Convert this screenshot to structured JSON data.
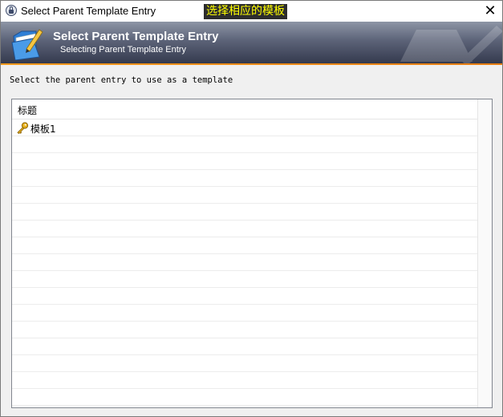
{
  "window": {
    "title": "Select Parent Template Entry",
    "close_glyph": "✕"
  },
  "annotation": "选择相应的模板",
  "banner": {
    "title": "Select Parent Template Entry",
    "subtitle": "Selecting Parent Template Entry",
    "icon": "folder-pencil-icon",
    "accent_color": "#f39a1c"
  },
  "instruction": "Select the parent entry to use as a template",
  "list": {
    "column_header": "标题",
    "rows": [
      {
        "icon": "key-icon",
        "label": "模板1"
      }
    ]
  }
}
